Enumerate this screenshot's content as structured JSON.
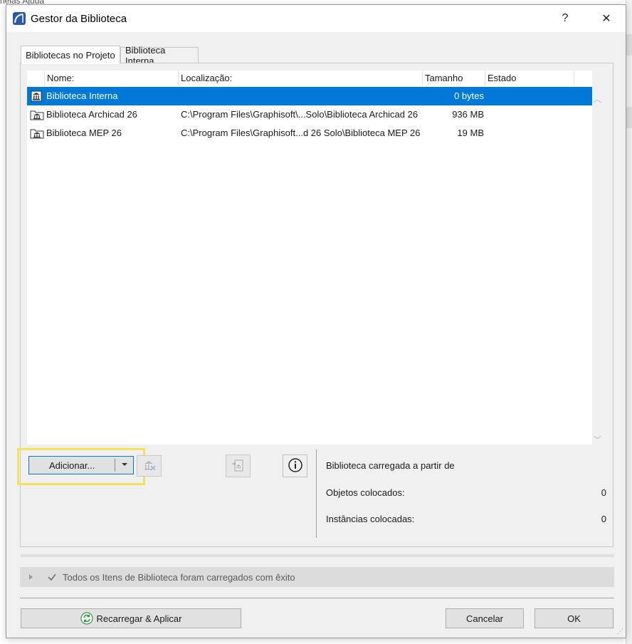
{
  "background": {
    "menu_text": "nelas   Ajuda"
  },
  "window": {
    "title": "Gestor da Biblioteca",
    "help_label": "?",
    "close_label": "✕"
  },
  "tabs": [
    {
      "label": "Bibliotecas no Projeto",
      "active": true
    },
    {
      "label": "Biblioteca Interna",
      "active": false
    }
  ],
  "list": {
    "columns": [
      "Nome:",
      "Localização:",
      "Tamanho",
      "Estado"
    ],
    "rows": [
      {
        "icon": "library-icon",
        "name": "Biblioteca Interna",
        "location": "",
        "size": "0 bytes",
        "state": "",
        "selected": true
      },
      {
        "icon": "library-folder-icon",
        "name": "Biblioteca Archicad 26",
        "location": "C:\\Program Files\\Graphisoft\\...Solo\\Biblioteca Archicad 26",
        "size": "936 MB",
        "state": "",
        "selected": false
      },
      {
        "icon": "library-folder-icon",
        "name": "Biblioteca MEP 26",
        "location": "C:\\Program Files\\Graphisoft...d 26 Solo\\Biblioteca MEP 26",
        "size": "19 MB",
        "state": "",
        "selected": false
      }
    ]
  },
  "actions": {
    "add_label": "Adicionar...",
    "dropdown_icon": "triangle-down-icon"
  },
  "info": {
    "loaded_from_label": "Biblioteca carregada a partir de",
    "placed_objects_label": "Objetos colocados:",
    "placed_objects_value": "0",
    "placed_instances_label": "Instâncias colocadas:",
    "placed_instances_value": "0"
  },
  "status": {
    "message": "Todos os Itens de Biblioteca foram carregados com êxito"
  },
  "footer": {
    "reload_label": "Recarregar & Aplicar",
    "cancel_label": "Cancelar",
    "ok_label": "OK"
  },
  "colors": {
    "selection": "#0078d7",
    "highlight": "#f5e15a",
    "reload_icon": "#2e9e3e"
  }
}
